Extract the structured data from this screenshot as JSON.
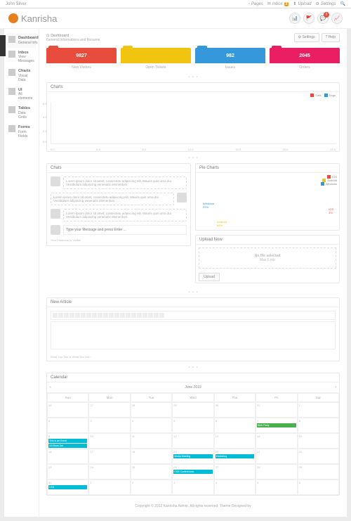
{
  "topbar": {
    "user": "John Silver",
    "links": [
      "Pages",
      "Inbox",
      "Upload",
      "Settings"
    ],
    "inbox_badge": "3"
  },
  "brand": "Kanrisha",
  "header_icons": {
    "notif": "2"
  },
  "sidebar": [
    {
      "title": "Dashboard",
      "sub": "General Info"
    },
    {
      "title": "Inbox",
      "sub": "View Messages"
    },
    {
      "title": "Charts",
      "sub": "Visual Data"
    },
    {
      "title": "UI",
      "sub": "All elements"
    },
    {
      "title": "Tables",
      "sub": "Data Grids"
    },
    {
      "title": "Forms",
      "sub": "Form Fields"
    }
  ],
  "page": {
    "title": "Dashboard",
    "sub": "General Informations and Resume",
    "btn1": "Settings",
    "btn2": "Help"
  },
  "stats": [
    {
      "val": "9827",
      "label": "New Visitors",
      "color": "f1"
    },
    {
      "val": "",
      "label": "Open Tickets",
      "color": "f2"
    },
    {
      "val": "982",
      "label": "Issues",
      "color": "f3"
    },
    {
      "val": "2045",
      "label": "Orders",
      "color": "f4"
    }
  ],
  "chart": {
    "title": "Charts",
    "legend": [
      {
        "name": "Cats",
        "color": "#e74c3c"
      },
      {
        "name": "Dogs",
        "color": "#3498db"
      }
    ],
    "yticks": [
      "6.0",
      "4.0",
      "2.0",
      "0.0"
    ],
    "xticks": [
      "0.0",
      "4.0",
      "8.0",
      "12.0",
      "16.0",
      "20.0",
      "24.0"
    ]
  },
  "chart_data": {
    "type": "line",
    "x": [
      0,
      4,
      8,
      12,
      16,
      20,
      24
    ],
    "series": [
      {
        "name": "Cats",
        "values": [
          0,
          0,
          0,
          0,
          0,
          0,
          0
        ]
      },
      {
        "name": "Dogs",
        "values": [
          0,
          0,
          0,
          0,
          0,
          0,
          0
        ]
      }
    ],
    "ylim": [
      0,
      6
    ],
    "xlim": [
      0,
      24
    ]
  },
  "chats": {
    "title": "Chats",
    "msgs": [
      "Lorem ipsum dolor sit amet, consectetu adipiscing elit. Mauris quis urna dui. Vestibulum adipiscing venenatis elementum.",
      "Lorem ipsum dolor sit amet, consectetu adipiscing elit. Mauris quis urna dui. Vestibulum adipiscing venenatis elementum.",
      "Lorem ipsum dolor sit amet, consectetu adipiscing elit. Mauris quis urna dui. Vestibulum adipiscing venenatis elementum."
    ],
    "placeholder": "Type your Message and press Enter ...",
    "note": "Your Presence is Visible"
  },
  "pie": {
    "title": "Pie Charts",
    "legend": [
      {
        "name": "IOS",
        "color": "#e74c3c"
      },
      {
        "name": "Android",
        "color": "#f1c40f"
      },
      {
        "name": "Windows",
        "color": "#3498db"
      }
    ],
    "labels": [
      {
        "name": "Windows",
        "val": "29%",
        "pos": "left:10px;top:20px;color:#3498db"
      },
      {
        "name": "IOS",
        "val": "3%",
        "pos": "right:8px;top:28px;color:#e74c3c"
      },
      {
        "name": "Android",
        "val": "68%",
        "pos": "left:30px;bottom:4px;color:#f1c40f"
      }
    ]
  },
  "upload": {
    "title": "Upload Now",
    "text": "No file selected",
    "hint": "Max 5 mb",
    "btn": "Upload"
  },
  "article": {
    "title": "New Article",
    "hint": "What You See Is What You Get !"
  },
  "calendar": {
    "title": "Calendar",
    "month": "June 2019",
    "days": [
      "Sun",
      "Mon",
      "Tue",
      "Wed",
      "Thu",
      "Fri",
      "Sat"
    ],
    "cells": [
      [
        "26",
        "27",
        "28",
        "29",
        "30",
        "31",
        "1"
      ],
      [
        "2",
        "3",
        "4",
        "5",
        "6",
        "7",
        "8"
      ],
      [
        "9",
        "10",
        "11",
        "12",
        "13",
        "14",
        "15"
      ],
      [
        "16",
        "17",
        "18",
        "19",
        "20",
        "21",
        "22"
      ],
      [
        "23",
        "24",
        "25",
        "26",
        "27",
        "28",
        "29"
      ],
      [
        "30",
        "1",
        "2",
        "3",
        "4",
        "5",
        "6"
      ]
    ],
    "events": {
      "1_5": {
        "text": "Birth Party",
        "cls": "g"
      },
      "2_0": {
        "text": "This is an Event",
        "cls": ""
      },
      "2_0b": {
        "text": "10:00am Job",
        "cls": ""
      },
      "3_3": {
        "text": "Media Meeting",
        "cls": ""
      },
      "3_4": {
        "text": "Marketing",
        "cls": ""
      },
      "4_3": {
        "text": "CSS Conferences",
        "cls": ""
      },
      "5_0": {
        "text": "CSS",
        "cls": ""
      }
    }
  },
  "footer": "Copyright © 2012 Kanrisha Admin. All rights reserved. Theme Designed by"
}
